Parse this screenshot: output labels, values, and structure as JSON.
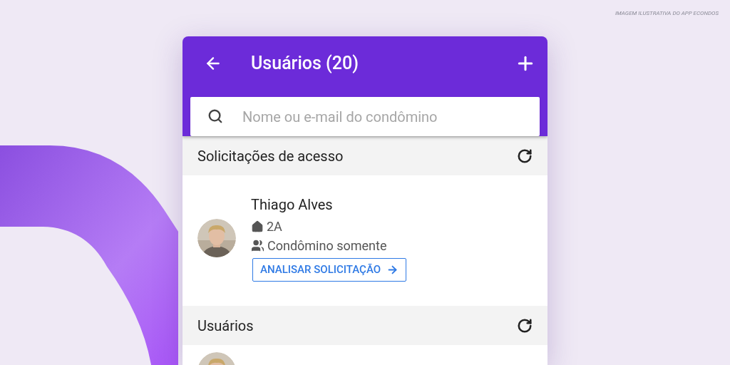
{
  "caption": "IMAGEM ILUSTRATIVA DO APP ECONDOS",
  "header": {
    "title": "Usuários (20)"
  },
  "search": {
    "placeholder": "Nome ou e-mail do condômino"
  },
  "sections": [
    {
      "title": "Solicitações de acesso",
      "items": [
        {
          "name": "Thiago Alves",
          "unit": "2A",
          "role": "Condômino somente",
          "action": "ANALISAR SOLICITAÇÃO"
        }
      ]
    },
    {
      "title": "Usuários"
    }
  ]
}
